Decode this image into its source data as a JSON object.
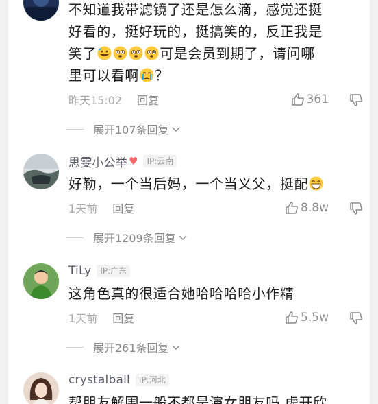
{
  "comments": [
    {
      "username": "",
      "ip": "",
      "lines": [
        "不知道我带滤镜了还是怎么滴，感觉还挺",
        "好看的，挺好玩的，挺搞笑的，反正我是"
      ],
      "line3_start": "笑了",
      "line3_mid": "可是会员到期了，请问哪",
      "line4_start": "里可以看啊",
      "line4_end": "？",
      "time": "昨天15:02",
      "reply_label": "回复",
      "likes": "361",
      "expand_label": "展开107条回复",
      "emoji": [
        "rofl-emoji",
        "flushed-emoji",
        "flushed-emoji",
        "flushed-emoji",
        "crying-emoji"
      ],
      "avatar": "avatar-dark-blue"
    },
    {
      "username": "思雯小公举",
      "ip": "IP:云南",
      "heart": "♥",
      "text": "好勒，一个当后妈，一个当义父，挺配",
      "time": "1天前",
      "reply_label": "回复",
      "likes": "8.8w",
      "expand_label": "展开1209条回复",
      "emoji": [
        "grin-emoji"
      ],
      "avatar": "avatar-landscape"
    },
    {
      "username": "TiLy",
      "ip": "IP:广东",
      "text": "这角色真的很适合她哈哈哈哈小作精",
      "time": "1天前",
      "reply_label": "回复",
      "likes": "5.5w",
      "expand_label": "展开261条回复",
      "avatar": "avatar-child-green"
    },
    {
      "username": "crystalball",
      "ip": "IP:河北",
      "text": "帮朋友解围一般不都是演女朋友吗 虚开欣",
      "avatar": "avatar-girl"
    }
  ],
  "colors": {
    "username": "#5b5b6b",
    "text": "#1f1f1f",
    "muted": "#a8a8a8",
    "heart": "#f06a6a"
  }
}
